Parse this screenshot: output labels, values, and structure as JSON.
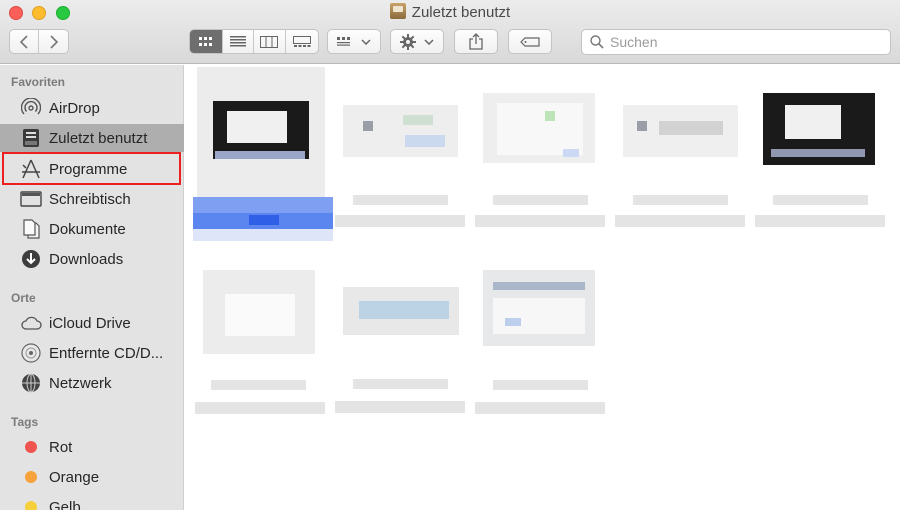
{
  "window": {
    "title": "Zuletzt benutzt",
    "title_icon": "recents-icon"
  },
  "toolbar": {
    "back_icon": "chevron-left-icon",
    "forward_icon": "chevron-right-icon",
    "view_modes": [
      "icon-view-icon",
      "list-view-icon",
      "column-view-icon",
      "gallery-view-icon"
    ],
    "active_view": "icon-view-icon",
    "group_icon": "group-by-icon",
    "action_icon": "gear-icon",
    "share_icon": "share-icon",
    "tag_icon": "tag-icon",
    "search_placeholder": "Suchen"
  },
  "sidebar": {
    "sections": [
      {
        "title": "Favoriten",
        "items": [
          {
            "label": "AirDrop",
            "icon": "airdrop-icon"
          },
          {
            "label": "Zuletzt benutzt",
            "icon": "recents-icon",
            "selected": true
          },
          {
            "label": "Programme",
            "icon": "applications-icon",
            "highlighted": true
          },
          {
            "label": "Schreibtisch",
            "icon": "desktop-icon"
          },
          {
            "label": "Dokumente",
            "icon": "document-icon"
          },
          {
            "label": "Downloads",
            "icon": "download-icon"
          }
        ]
      },
      {
        "title": "Orte",
        "items": [
          {
            "label": "iCloud Drive",
            "icon": "cloud-icon"
          },
          {
            "label": "Entfernte CD/D...",
            "icon": "disc-icon"
          },
          {
            "label": "Netzwerk",
            "icon": "network-icon"
          }
        ]
      },
      {
        "title": "Tags",
        "items": [
          {
            "label": "Rot",
            "color": "#f0544f"
          },
          {
            "label": "Orange",
            "color": "#f7a23b"
          },
          {
            "label": "Gelb",
            "color": "#f5cf3c"
          }
        ]
      }
    ]
  },
  "colors": {
    "highlight_border": "#ec2020",
    "selection": "#aeaeae",
    "file_selection": "#5b86f0"
  }
}
